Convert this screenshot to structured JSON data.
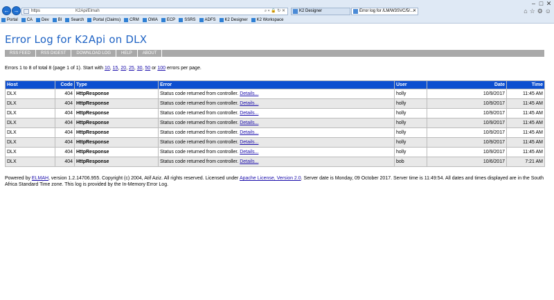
{
  "browser": {
    "address_prefix": "https",
    "address_path": "K2Api/Elmah",
    "tabs": [
      {
        "label": "K2 Designer"
      },
      {
        "label": "Error log for /LM/W3SVC/5/..."
      }
    ],
    "favorites": [
      "Portal",
      "CA",
      "Dev",
      "BI",
      "Search",
      "Portal (Claims)",
      "CRM",
      "OWA",
      "ECP",
      "SSRS",
      "ADFS",
      "K2 Designer",
      "K2 Workspace"
    ],
    "colors": {
      "chrome": "#dfe9f5",
      "nav": "#1f6fd1"
    }
  },
  "page": {
    "title": "Error Log for K2Api on DLX",
    "speedbar": [
      "RSS FEED",
      "RSS DIGEST",
      "DOWNLOAD LOG",
      "HELP",
      "ABOUT"
    ],
    "summary": {
      "prefix": "Errors 1 to 8 of total 8 (page 1 of 1). Start with",
      "options": [
        "10",
        "15",
        "20",
        "25",
        "30",
        "50"
      ],
      "or": "or",
      "last_option": "100",
      "suffix": "errors per page."
    },
    "table": {
      "headers": {
        "host": "Host",
        "code": "Code",
        "type": "Type",
        "error": "Error",
        "user": "User",
        "date": "Date",
        "time": "Time"
      },
      "details_link": "Details...",
      "rows": [
        {
          "host": "DLX",
          "code": "404",
          "type": "HttpResponse",
          "error": "Status code returned from controller.",
          "user": "holly",
          "date": "10/9/2017",
          "time": "11:45 AM"
        },
        {
          "host": "DLX",
          "code": "404",
          "type": "HttpResponse",
          "error": "Status code returned from controller.",
          "user": "holly",
          "date": "10/9/2017",
          "time": "11:45 AM"
        },
        {
          "host": "DLX",
          "code": "404",
          "type": "HttpResponse",
          "error": "Status code returned from controller.",
          "user": "holly",
          "date": "10/9/2017",
          "time": "11:45 AM"
        },
        {
          "host": "DLX",
          "code": "404",
          "type": "HttpResponse",
          "error": "Status code returned from controller.",
          "user": "holly",
          "date": "10/9/2017",
          "time": "11:45 AM"
        },
        {
          "host": "DLX",
          "code": "404",
          "type": "HttpResponse",
          "error": "Status code returned from controller.",
          "user": "holly",
          "date": "10/9/2017",
          "time": "11:45 AM"
        },
        {
          "host": "DLX",
          "code": "404",
          "type": "HttpResponse",
          "error": "Status code returned from controller.",
          "user": "holly",
          "date": "10/9/2017",
          "time": "11:45 AM"
        },
        {
          "host": "DLX",
          "code": "404",
          "type": "HttpResponse",
          "error": "Status code returned from controller.",
          "user": "holly",
          "date": "10/9/2017",
          "time": "11:45 AM"
        },
        {
          "host": "DLX",
          "code": "404",
          "type": "HttpResponse",
          "error": "Status code returned from controller.",
          "user": "bob",
          "date": "10/6/2017",
          "time": "7:21 AM"
        }
      ]
    },
    "footer": {
      "powered_by": "Powered by",
      "elmah_link": "ELMAH",
      "middle": ", version 1.2.14706.955. Copyright (c) 2004, Atif Aziz. All rights reserved. Licensed under",
      "license_link": "Apache License, Version 2.0",
      "end": ". Server date is Monday, 09 October 2017. Server time is 11:49:54. All dates and times displayed are in the South Africa Standard Time zone. This log is provided by the In-Memory Error Log."
    },
    "colors": {
      "title": "#1f63c4",
      "header_bg": "#0d4fd0",
      "speedbar_bg": "#a9a9a9",
      "row_alt": "#e8e8e8"
    }
  }
}
